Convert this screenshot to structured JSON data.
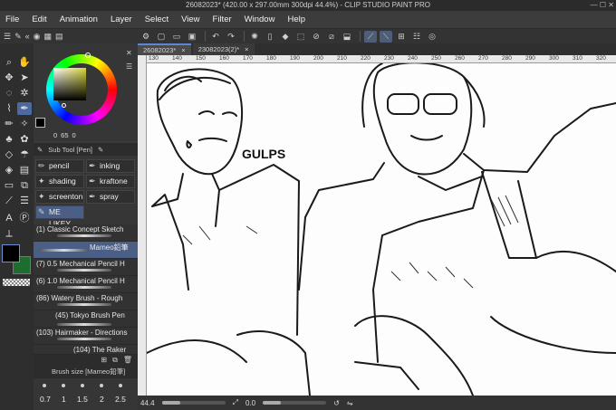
{
  "window": {
    "title": "26082023* (420.00 x 297.00mm 300dpi 44.4%) - CLIP STUDIO PAINT PRO",
    "controls": "—  ☐  ✕"
  },
  "menu": [
    "File",
    "Edit",
    "Animation",
    "Layer",
    "Select",
    "View",
    "Filter",
    "Window",
    "Help"
  ],
  "color": {
    "values": [
      "0",
      "65",
      "0"
    ],
    "fg": "#000000",
    "bg": "#1c6d2f"
  },
  "subtool": {
    "header": "Sub Tool [Pen]",
    "buttons": [
      {
        "label": "pencil",
        "icon": "pencil-icon"
      },
      {
        "label": "inking",
        "icon": "ink-icon"
      },
      {
        "label": "shading",
        "icon": "shading-icon"
      },
      {
        "label": "kraftone",
        "icon": "kraftone-icon"
      },
      {
        "label": "screenton",
        "icon": "screentone-icon"
      },
      {
        "label": "spray",
        "icon": "spray-icon"
      },
      {
        "label": "ME LIKEY",
        "icon": "pen-icon"
      }
    ]
  },
  "brushes": [
    "(1) Classic Concept Sketch",
    "Mameo鉛筆",
    "(7) 0.5 Mechanical Pencil H",
    "(6) 1.0 Mechanical Pencil H",
    "(86) Watery Brush - Rough",
    "(45) Tokyo Brush Pen",
    "(103) Hairmaker - Directions",
    "(104) The Raker"
  ],
  "brush_size": {
    "header": "Brush size [Mameo鉛筆]",
    "values": [
      "0.7",
      "1",
      "1.5",
      "2",
      "2.5"
    ]
  },
  "tabs": [
    {
      "label": "26082023*",
      "close": "×"
    },
    {
      "label": "23082023(2)*",
      "close": "×"
    }
  ],
  "ruler": [
    "130",
    "140",
    "150",
    "160",
    "170",
    "180",
    "190",
    "200",
    "210",
    "220",
    "230",
    "240",
    "250",
    "260",
    "270",
    "280",
    "290",
    "300",
    "310",
    "320"
  ],
  "canvas": {
    "sfx_text": "GULPS"
  },
  "status": {
    "zoom": "44.4",
    "angle": "0.0"
  }
}
